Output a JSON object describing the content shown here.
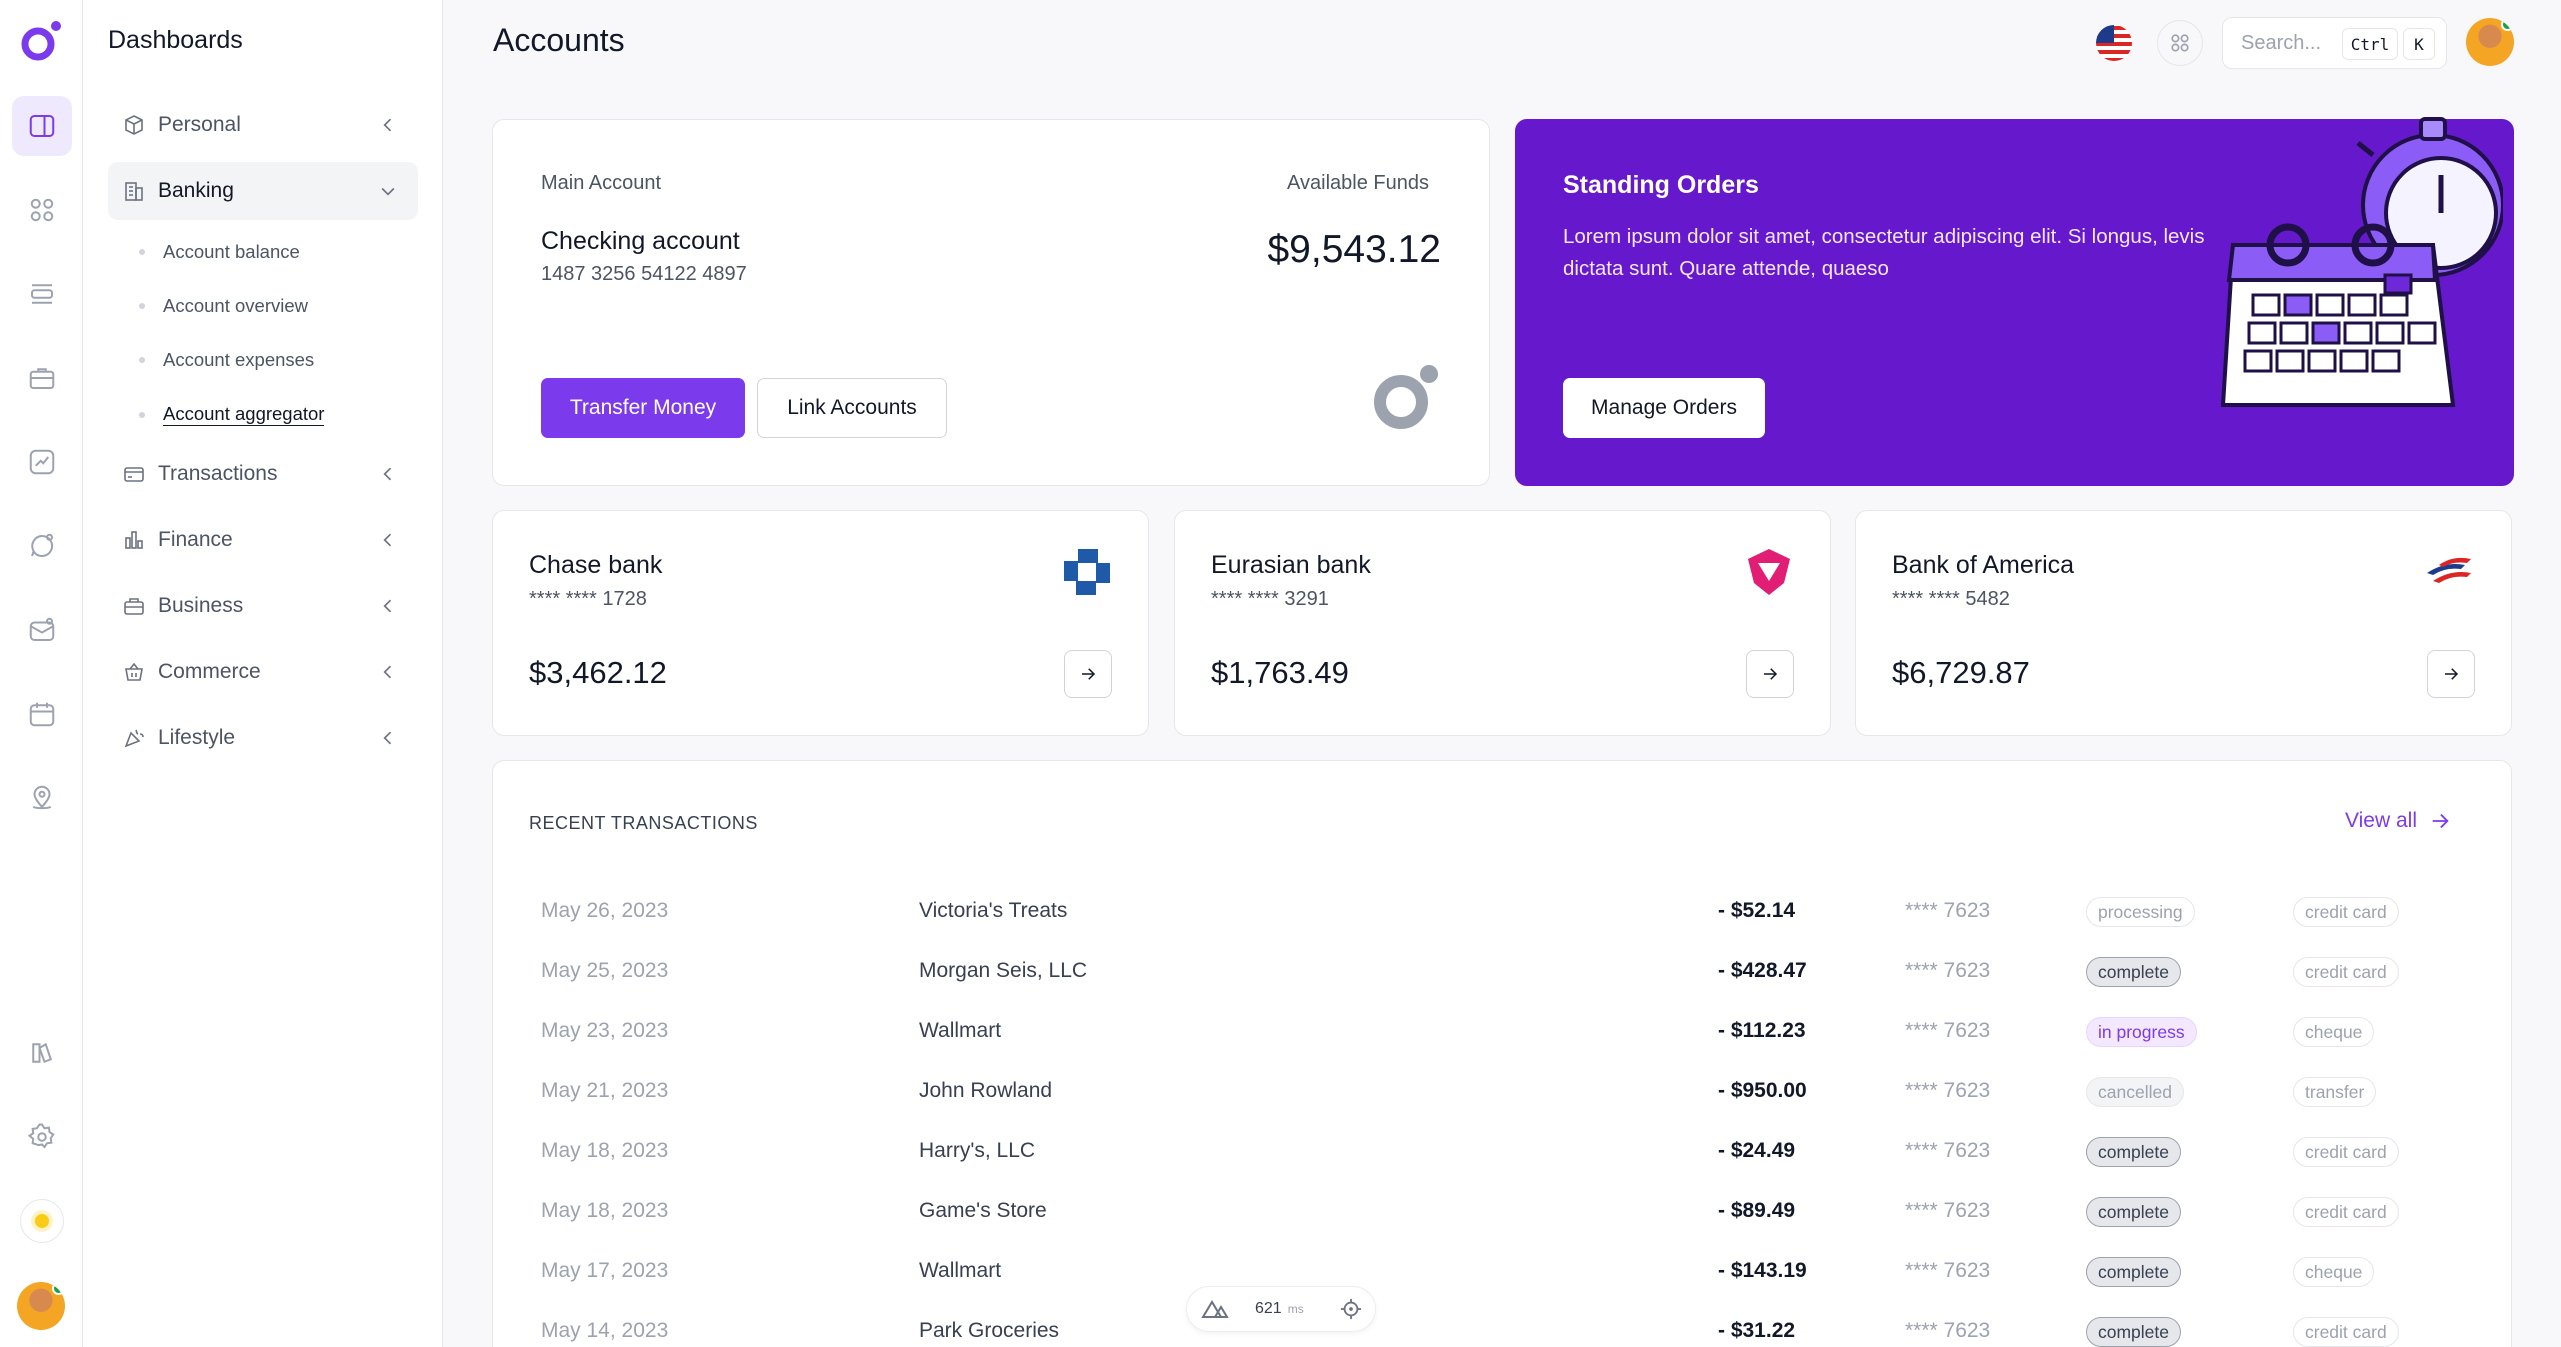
{
  "sidebar": {
    "title": "Dashboards",
    "items": [
      {
        "label": "Personal"
      },
      {
        "label": "Banking"
      },
      {
        "label": "Transactions"
      },
      {
        "label": "Finance"
      },
      {
        "label": "Business"
      },
      {
        "label": "Commerce"
      },
      {
        "label": "Lifestyle"
      }
    ],
    "banking_sub": [
      {
        "label": "Account balance"
      },
      {
        "label": "Account overview"
      },
      {
        "label": "Account expenses"
      },
      {
        "label": "Account aggregator"
      }
    ]
  },
  "header": {
    "title": "Accounts",
    "search_placeholder": "Search...",
    "kbd_ctrl": "Ctrl",
    "kbd_k": "K"
  },
  "main_account": {
    "label": "Main Account",
    "funds_label": "Available Funds",
    "name": "Checking account",
    "number": "1487 3256 54122 4897",
    "funds": "$9,543.12",
    "transfer_label": "Transfer Money",
    "link_label": "Link Accounts"
  },
  "promo": {
    "title": "Standing Orders",
    "text": "Lorem ipsum dolor sit amet, consectetur adipiscing elit. Si longus, levis dictata sunt. Quare attende, quaeso",
    "button": "Manage Orders"
  },
  "banks": [
    {
      "name": "Chase bank",
      "number": "**** **** 1728",
      "balance": "$3,462.12"
    },
    {
      "name": "Eurasian bank",
      "number": "**** **** 3291",
      "balance": "$1,763.49"
    },
    {
      "name": "Bank of America",
      "number": "**** **** 5482",
      "balance": "$6,729.87"
    }
  ],
  "transactions": {
    "heading": "RECENT TRANSACTIONS",
    "view_all": "View all",
    "rows": [
      {
        "date": "May 26, 2023",
        "merchant": "Victoria's Treats",
        "amount": "- $52.14",
        "card": "**** 7623",
        "status": "processing",
        "method": "credit card"
      },
      {
        "date": "May 25, 2023",
        "merchant": "Morgan Seis, LLC",
        "amount": "- $428.47",
        "card": "**** 7623",
        "status": "complete",
        "method": "credit card"
      },
      {
        "date": "May 23, 2023",
        "merchant": "Wallmart",
        "amount": "- $112.23",
        "card": "**** 7623",
        "status": "in progress",
        "method": "cheque"
      },
      {
        "date": "May 21, 2023",
        "merchant": "John Rowland",
        "amount": "- $950.00",
        "card": "**** 7623",
        "status": "cancelled",
        "method": "transfer"
      },
      {
        "date": "May 18, 2023",
        "merchant": "Harry's, LLC",
        "amount": "- $24.49",
        "card": "**** 7623",
        "status": "complete",
        "method": "credit card"
      },
      {
        "date": "May 18, 2023",
        "merchant": "Game's Store",
        "amount": "- $89.49",
        "card": "**** 7623",
        "status": "complete",
        "method": "credit card"
      },
      {
        "date": "May 17, 2023",
        "merchant": "Wallmart",
        "amount": "- $143.19",
        "card": "**** 7623",
        "status": "complete",
        "method": "cheque"
      },
      {
        "date": "May 14, 2023",
        "merchant": "Park Groceries",
        "amount": "- $31.22",
        "card": "**** 7623",
        "status": "complete",
        "method": "credit card"
      }
    ]
  },
  "perf": {
    "value": "621",
    "unit": "ms"
  },
  "colors": {
    "accent": "#7c3aed",
    "promo_bg": "#6518cc"
  }
}
